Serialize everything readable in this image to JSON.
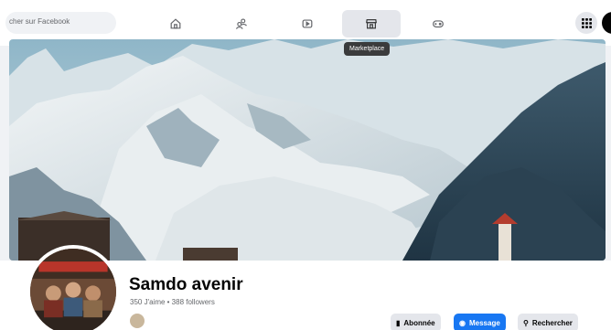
{
  "topbar": {
    "search_placeholder": "cher sur Facebook",
    "nav_tabs": [
      {
        "icon": "home-icon"
      },
      {
        "icon": "friends-icon"
      },
      {
        "icon": "watch-icon"
      },
      {
        "icon": "marketplace-icon",
        "active": true
      },
      {
        "icon": "gaming-icon"
      }
    ],
    "tooltip": "Marketplace"
  },
  "profile": {
    "name": "Samdo avenir",
    "stats": "350 J'aime • 388 followers"
  },
  "actions": {
    "subscribed": "Abonnée",
    "message": "Message",
    "search": "Rechercher"
  },
  "colors": {
    "accent": "#1877f2",
    "bar_bg": "#ffffff",
    "page_bg": "#f0f2f5",
    "button_gray": "#e4e6eb"
  }
}
